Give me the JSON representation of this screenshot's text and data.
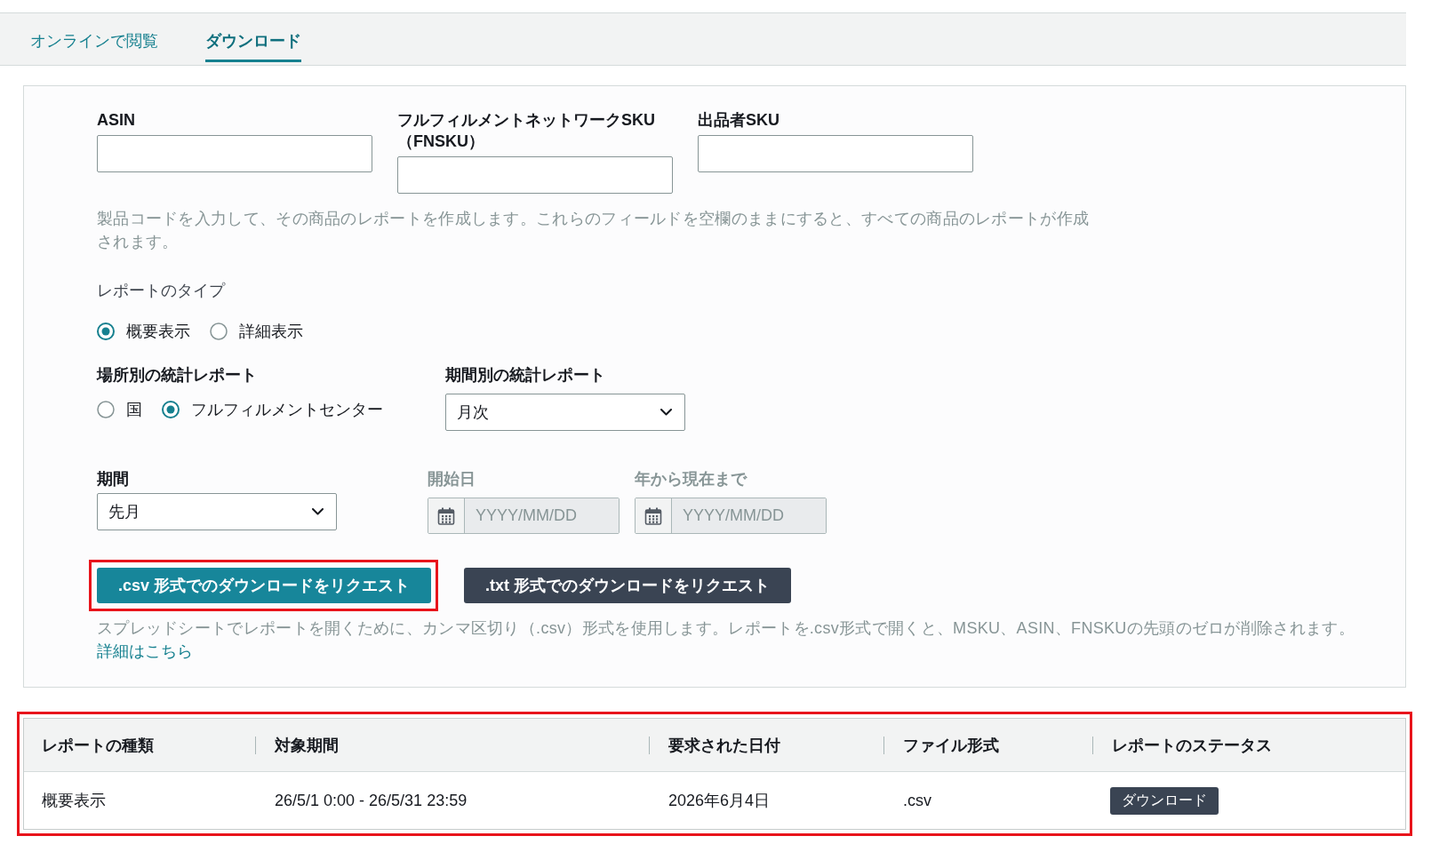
{
  "tabs": [
    {
      "label": "オンラインで閲覧",
      "selected": false
    },
    {
      "label": "ダウンロード",
      "selected": true
    }
  ],
  "product_fields": [
    {
      "label": "ASIN"
    },
    {
      "label": "フルフィルメントネットワークSKU（FNSKU）"
    },
    {
      "label": "出品者SKU"
    }
  ],
  "product_help": "製品コードを入力して、その商品のレポートを作成します。これらのフィールドを空欄のままにすると、すべての商品のレポートが作成されます。",
  "report_type": {
    "label": "レポートのタイプ",
    "options": [
      {
        "label": "概要表示",
        "selected": true
      },
      {
        "label": "詳細表示",
        "selected": false
      }
    ]
  },
  "location_stats": {
    "label": "場所別の統計レポート",
    "options": [
      {
        "label": "国",
        "selected": false
      },
      {
        "label": "フルフィルメントセンター",
        "selected": true
      }
    ]
  },
  "period_stats": {
    "label": "期間別の統計レポート",
    "value": "月次"
  },
  "period": {
    "label": "期間",
    "value": "先月"
  },
  "date_fields": [
    {
      "label": "開始日",
      "placeholder": "YYYY/MM/DD",
      "disabled": true
    },
    {
      "label": "年から現在まで",
      "placeholder": "YYYY/MM/DD",
      "disabled": true
    }
  ],
  "download_buttons": [
    {
      "label": ".csv 形式でのダウンロードをリクエスト",
      "kind": "primary",
      "highlighted": true
    },
    {
      "label": ".txt 形式でのダウンロードをリクエスト",
      "kind": "secondary",
      "highlighted": false
    }
  ],
  "format_help": "スプレッドシートでレポートを開くために、カンマ区切り（.csv）形式を使用します。レポートを.csv形式で開くと、MSKU、ASIN、FNSKUの先頭のゼロが削除されます。",
  "learn_more_link": "詳細はこちら",
  "report_table": {
    "highlighted": true,
    "columns": [
      "レポートの種類",
      "対象期間",
      "要求された日付",
      "ファイル形式",
      "レポートのステータス"
    ],
    "rows": [
      {
        "cells": [
          {
            "kind": "text",
            "text": "概要表示"
          },
          {
            "kind": "text",
            "text": "26/5/1 0:00 - 26/5/31 23:59"
          },
          {
            "kind": "text",
            "text": "2026年6月4日"
          },
          {
            "kind": "text",
            "text": ".csv"
          },
          {
            "kind": "button",
            "text": "ダウンロード"
          }
        ]
      }
    ]
  }
}
